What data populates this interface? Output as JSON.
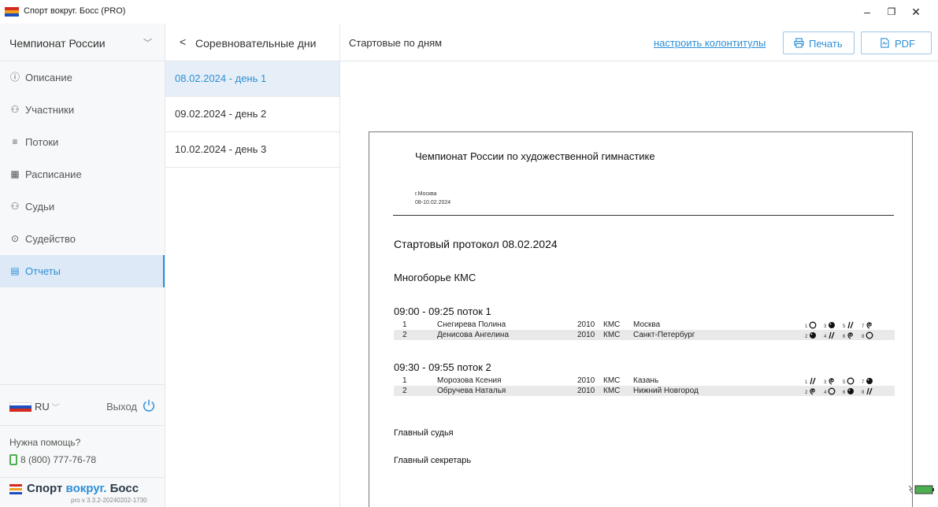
{
  "window": {
    "title": "Спорт вокруг. Босс (PRO)",
    "minimize_glyph": "–",
    "restore_glyph": "❐",
    "close_glyph": "✕"
  },
  "sidebar": {
    "championship": "Чемпионат России",
    "items": [
      {
        "label": "Описание",
        "icon": "info-icon"
      },
      {
        "label": "Участники",
        "icon": "people-icon"
      },
      {
        "label": "Потоки",
        "icon": "list-icon"
      },
      {
        "label": "Расписание",
        "icon": "calendar-icon"
      },
      {
        "label": "Судьи",
        "icon": "judges-icon"
      },
      {
        "label": "Судейство",
        "icon": "play-icon"
      },
      {
        "label": "Отчеты",
        "icon": "report-icon"
      }
    ],
    "active_index": 6,
    "language": "RU",
    "logout": "Выход",
    "help_question": "Нужна помощь?",
    "phone": "8 (800) 777-76-78",
    "brand_part1": "Спорт",
    "brand_part2": "вокруг.",
    "brand_part3": "Босс",
    "version": "pro v 3.3.2-20240202-1730"
  },
  "days_panel": {
    "header": "Соревновательные дни",
    "days": [
      "08.02.2024 - день 1",
      "09.02.2024 - день 2",
      "10.02.2024 - день 3"
    ],
    "active_index": 0
  },
  "main": {
    "title": "Стартовые по дням",
    "headers_link": "настроить колонтитулы",
    "print_label": "Печать",
    "pdf_label": "PDF"
  },
  "document": {
    "title": "Чемпионат России по художественной гимнастике",
    "city": "г.Москва",
    "dates": "08-10.02.2024",
    "protocol": "Стартовый протокол 08.02.2024",
    "event": "Многоборье КМС",
    "flows": [
      {
        "title": "09:00 - 09:25 поток 1",
        "rows": [
          {
            "num": "1",
            "name": "Снегирева Полина",
            "year": "2010",
            "rank": "КМС",
            "city": "Москва",
            "apparatus": [
              {
                "n": "1",
                "t": "hoop"
              },
              {
                "n": "3",
                "t": "ball"
              },
              {
                "n": "5",
                "t": "clubs"
              },
              {
                "n": "7",
                "t": "ribbon"
              }
            ]
          },
          {
            "num": "2",
            "name": "Денисова Ангелина",
            "year": "2010",
            "rank": "КМС",
            "city": "Санкт-Петербург",
            "apparatus": [
              {
                "n": "2",
                "t": "ball"
              },
              {
                "n": "4",
                "t": "clubs"
              },
              {
                "n": "6",
                "t": "ribbon"
              },
              {
                "n": "8",
                "t": "hoop"
              }
            ]
          }
        ]
      },
      {
        "title": "09:30 - 09:55 поток 2",
        "rows": [
          {
            "num": "1",
            "name": "Морозова Ксения",
            "year": "2010",
            "rank": "КМС",
            "city": "Казань",
            "apparatus": [
              {
                "n": "1",
                "t": "clubs"
              },
              {
                "n": "3",
                "t": "ribbon"
              },
              {
                "n": "5",
                "t": "hoop"
              },
              {
                "n": "7",
                "t": "ball"
              }
            ]
          },
          {
            "num": "2",
            "name": "Обручева Наталья",
            "year": "2010",
            "rank": "КМС",
            "city": "Нижний Новгород",
            "apparatus": [
              {
                "n": "2",
                "t": "ribbon"
              },
              {
                "n": "4",
                "t": "hoop"
              },
              {
                "n": "6",
                "t": "ball"
              },
              {
                "n": "8",
                "t": "clubs"
              }
            ]
          }
        ]
      }
    ],
    "chief_judge": "Главный судья",
    "chief_secretary": "Главный секретарь"
  },
  "colors": {
    "accent": "#2b8fd6",
    "active_bg": "#dde9f6",
    "flag_white": "#ffffff",
    "flag_blue": "#1f4fbf",
    "flag_red": "#d52b1e"
  }
}
